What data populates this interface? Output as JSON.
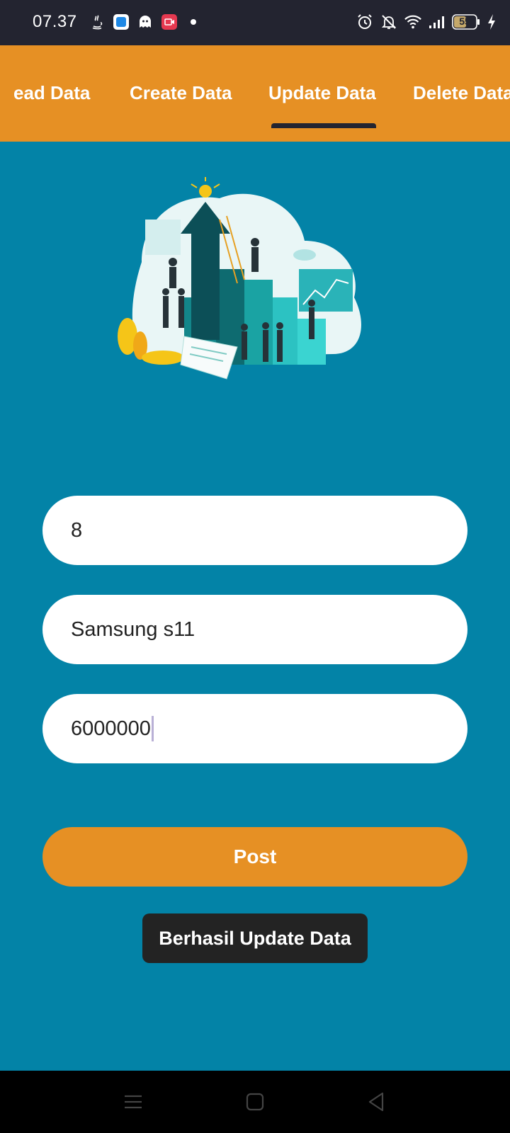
{
  "status_bar": {
    "time": "07.37",
    "battery": "55",
    "icons_left": [
      "java-icon",
      "app-blue-icon",
      "ghost-icon",
      "video-record-icon",
      "dot-icon"
    ],
    "icons_right": [
      "alarm-icon",
      "bell-off-icon",
      "wifi-icon",
      "signal-icon",
      "battery-icon",
      "charging-icon"
    ]
  },
  "tabs": [
    {
      "label": "Read Data",
      "shown": "ead Data"
    },
    {
      "label": "Create Data"
    },
    {
      "label": "Update Data",
      "selected": true
    },
    {
      "label": "Delete Data",
      "shown": "Delete Data"
    }
  ],
  "form": {
    "id_value": "8",
    "name_value": "Samsung s11",
    "price_value": "6000000"
  },
  "post_button": "Post",
  "toast": "Berhasil Update Data",
  "colors": {
    "primary_bg": "#0383a7",
    "accent": "#e69024",
    "dark": "#232430"
  },
  "nav_bar": [
    "menu-icon",
    "home-square-icon",
    "back-triangle-icon"
  ]
}
